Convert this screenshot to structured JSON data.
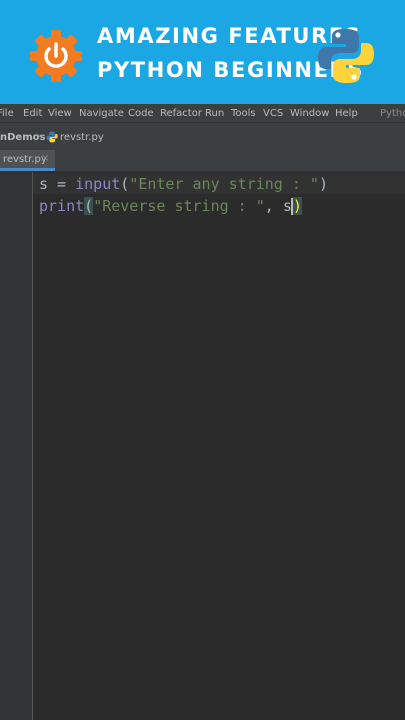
{
  "banner": {
    "line1": "AMAZING FEATURES",
    "line2": "PYTHON BEGINNERS",
    "colors": {
      "background": "#1ba7e3",
      "gear": "#f47c20",
      "python_blue": "#3f77ab",
      "python_yellow": "#ffd43b"
    },
    "icons": [
      "power-gear-icon",
      "python-logo-icon"
    ]
  },
  "menu": {
    "items": [
      "File",
      "Edit",
      "View",
      "Navigate",
      "Code",
      "Refactor",
      "Run",
      "Tools",
      "VCS",
      "Window",
      "Help"
    ],
    "project_label": "Python"
  },
  "navbar": {
    "project": "nDemos",
    "file": "revstr.py"
  },
  "tabs": [
    {
      "label": "revstr.py",
      "close": "×",
      "active": true
    }
  ],
  "editor": {
    "lines": [
      {
        "tokens": [
          {
            "text": "s = ",
            "kind": "plain"
          },
          {
            "text": "input",
            "kind": "builtin"
          },
          {
            "text": "(",
            "kind": "plain"
          },
          {
            "text": "\"Enter any string : \"",
            "kind": "string"
          },
          {
            "text": ")",
            "kind": "plain"
          }
        ]
      },
      {
        "tokens": [
          {
            "text": "print",
            "kind": "builtin"
          },
          {
            "text": "(",
            "kind": "paren"
          },
          {
            "text": "\"Reverse string : \"",
            "kind": "string"
          },
          {
            "text": ", s",
            "kind": "plain"
          },
          {
            "text": ")",
            "kind": "paren-match"
          }
        ]
      }
    ],
    "colors": {
      "background": "#2b2b2b",
      "builtin": "#8888c6",
      "string": "#6a8759",
      "text": "#a9b7c6"
    }
  }
}
